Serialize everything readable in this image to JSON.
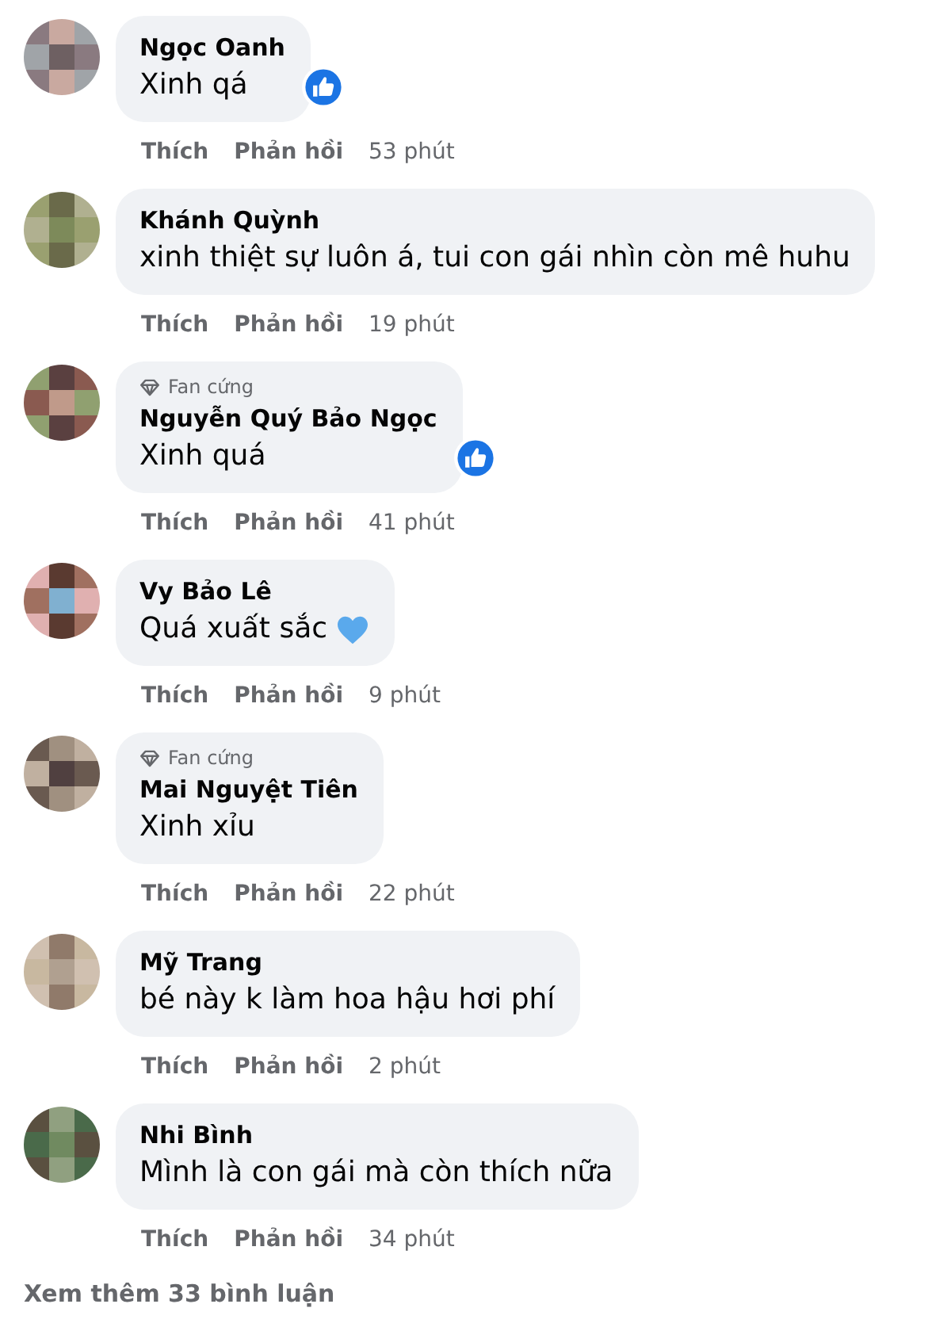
{
  "comments": [
    {
      "name": "Ngọc Oanh",
      "text": "Xinh qá",
      "liked": true,
      "actions": [
        "Thích",
        "Phản hồi"
      ],
      "time": "53 phút"
    },
    {
      "name": "Khánh Quỳnh",
      "text": "xinh thiệt sự luôn á, tui con gái nhìn còn mê huhu",
      "actions": [
        "Thích",
        "Phản hồi"
      ],
      "time": "19 phút"
    },
    {
      "name": "Nguyễn Quý Bảo Ngọc",
      "badge": "Fan cứng",
      "text": "Xinh quá",
      "liked": true,
      "actions": [
        "Thích",
        "Phản hồi"
      ],
      "time": "41 phút"
    },
    {
      "name": "Vy Bảo Lê",
      "text": "Quá xuất sắc",
      "heart_emoji": true,
      "actions": [
        "Thích",
        "Phản hồi"
      ],
      "time": "9 phút"
    },
    {
      "name": "Mai Nguyệt Tiên",
      "badge": "Fan cứng",
      "text": "Xinh xỉu",
      "actions": [
        "Thích",
        "Phản hồi"
      ],
      "time": "22 phút"
    },
    {
      "name": "Mỹ Trang",
      "text": "bé này k làm hoa hậu hơi phí",
      "actions": [
        "Thích",
        "Phản hồi"
      ],
      "time": "2 phút"
    },
    {
      "name": "Nhi Bình",
      "text": "Mình là con gái mà còn thích nữa",
      "actions": [
        "Thích",
        "Phản hồi"
      ],
      "time": "34 phút"
    }
  ],
  "more_comments": "Xem thêm 33 bình luận"
}
